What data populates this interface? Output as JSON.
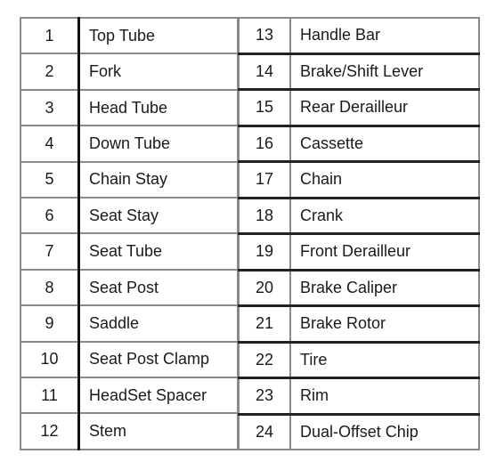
{
  "left_rows": [
    {
      "num": "1",
      "name": "Top Tube"
    },
    {
      "num": "2",
      "name": "Fork"
    },
    {
      "num": "3",
      "name": "Head Tube"
    },
    {
      "num": "4",
      "name": "Down Tube"
    },
    {
      "num": "5",
      "name": "Chain Stay"
    },
    {
      "num": "6",
      "name": "Seat Stay"
    },
    {
      "num": "7",
      "name": "Seat Tube"
    },
    {
      "num": "8",
      "name": "Seat Post"
    },
    {
      "num": "9",
      "name": "Saddle"
    },
    {
      "num": "10",
      "name": "Seat Post Clamp"
    },
    {
      "num": "11",
      "name": "HeadSet Spacer"
    },
    {
      "num": "12",
      "name": "Stem"
    }
  ],
  "right_rows": [
    {
      "num": "13",
      "name": "Handle Bar"
    },
    {
      "num": "14",
      "name": "Brake/Shift Lever"
    },
    {
      "num": "15",
      "name": "Rear Derailleur"
    },
    {
      "num": "16",
      "name": "Cassette"
    },
    {
      "num": "17",
      "name": "Chain"
    },
    {
      "num": "18",
      "name": "Crank"
    },
    {
      "num": "19",
      "name": "Front Derailleur"
    },
    {
      "num": "20",
      "name": "Brake Caliper"
    },
    {
      "num": "21",
      "name": "Brake Rotor"
    },
    {
      "num": "22",
      "name": "Tire"
    },
    {
      "num": "23",
      "name": "Rim"
    },
    {
      "num": "24",
      "name": "Dual-Offset Chip"
    }
  ]
}
